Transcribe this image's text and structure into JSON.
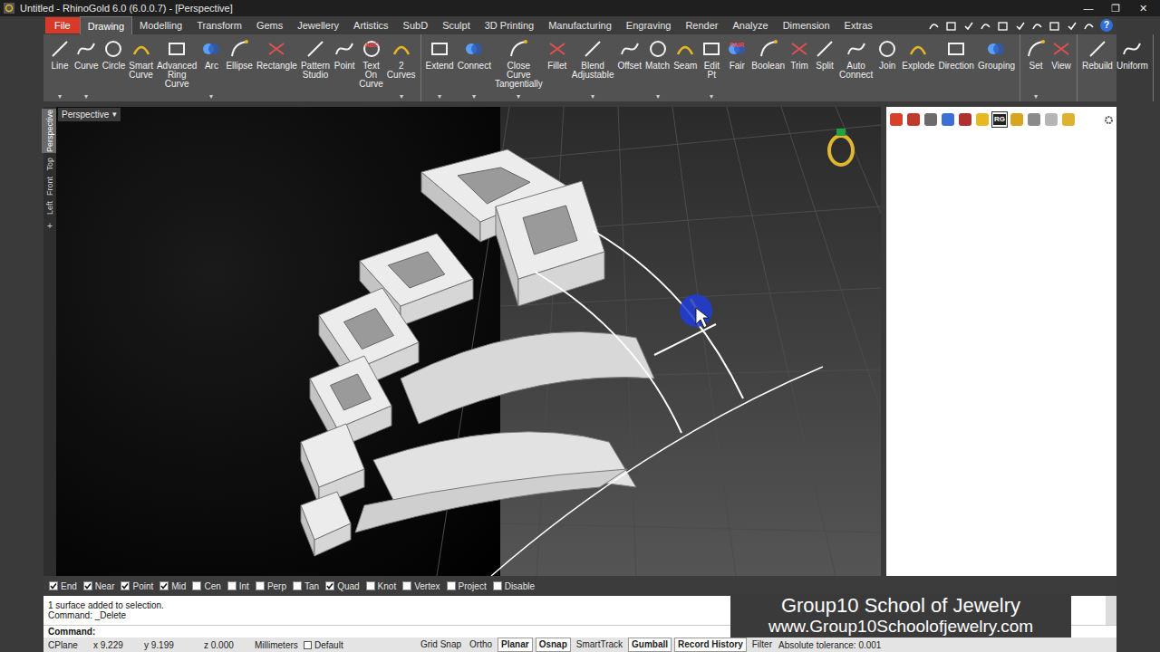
{
  "window": {
    "title": "Untitled - RhinoGold 6.0 (6.0.0.7) - [Perspective]",
    "controls": [
      "—",
      "❐",
      "✕"
    ]
  },
  "menu": {
    "file": "File",
    "help": "?",
    "tabs": [
      {
        "label": "Drawing",
        "selected": true
      },
      {
        "label": "Modelling",
        "selected": false
      },
      {
        "label": "Transform",
        "selected": false
      },
      {
        "label": "Gems",
        "selected": false
      },
      {
        "label": "Jewellery",
        "selected": false
      },
      {
        "label": "Artistics",
        "selected": false
      },
      {
        "label": "SubD",
        "selected": false
      },
      {
        "label": "Sculpt",
        "selected": false
      },
      {
        "label": "3D Printing",
        "selected": false
      },
      {
        "label": "Manufacturing",
        "selected": false
      },
      {
        "label": "Engraving",
        "selected": false
      },
      {
        "label": "Render",
        "selected": false
      },
      {
        "label": "Analyze",
        "selected": false
      },
      {
        "label": "Dimension",
        "selected": false
      },
      {
        "label": "Extras",
        "selected": false
      }
    ]
  },
  "ribbon": {
    "dropdown": "▾",
    "groups": [
      {
        "tools": [
          {
            "label": "Line",
            "menu": true
          },
          {
            "label": "Curve",
            "menu": true
          },
          {
            "label": "Circle",
            "menu": false
          },
          {
            "label": "Smart\nCurve",
            "menu": false
          },
          {
            "label": "Advanced\nRing Curve",
            "menu": false
          },
          {
            "label": "Arc",
            "menu": true
          },
          {
            "label": "Ellipse",
            "menu": false
          },
          {
            "label": "Rectangle",
            "menu": false
          },
          {
            "label": "Pattern\nStudio",
            "menu": false
          },
          {
            "label": "Point",
            "menu": false
          },
          {
            "label": "Text On\nCurve",
            "icon_text": "ABC",
            "menu": false
          },
          {
            "label": "2\nCurves",
            "menu": true
          }
        ]
      },
      {
        "tools": [
          {
            "label": "Extend",
            "menu": true
          },
          {
            "label": "Connect",
            "menu": true
          },
          {
            "label": "Close Curve\nTangentially",
            "menu": true
          },
          {
            "label": "Fillet",
            "menu": false
          },
          {
            "label": "Blend\nAdjustable",
            "menu": true
          },
          {
            "label": "Offset",
            "menu": false
          },
          {
            "label": "Match",
            "menu": true
          },
          {
            "label": "Seam",
            "menu": false
          },
          {
            "label": "Edit Pt",
            "menu": true
          },
          {
            "label": "Fair",
            "icon_text": "FAIR",
            "menu": false
          },
          {
            "label": "Boolean",
            "menu": false
          },
          {
            "label": "Trim",
            "menu": false
          },
          {
            "label": "Split",
            "menu": false
          },
          {
            "label": "Auto\nConnect",
            "menu": false
          },
          {
            "label": "Join",
            "menu": false
          },
          {
            "label": "Explode",
            "menu": false
          },
          {
            "label": "Direction",
            "menu": false
          },
          {
            "label": "Grouping",
            "menu": false
          }
        ]
      },
      {
        "tools": [
          {
            "label": "Set",
            "menu": true
          },
          {
            "label": "View",
            "menu": false
          }
        ]
      },
      {
        "tools": [
          {
            "label": "Rebuild",
            "menu": false
          },
          {
            "label": "Uniform",
            "menu": false
          }
        ]
      }
    ]
  },
  "viewport": {
    "label": "Perspective",
    "dropdown": "▾",
    "add": "+",
    "tabs": [
      {
        "label": "Perspective",
        "selected": true
      },
      {
        "label": "Top",
        "selected": false
      },
      {
        "label": "Front",
        "selected": false
      },
      {
        "label": "Left",
        "selected": false
      }
    ]
  },
  "panel": {
    "tabs": [
      {
        "selected": false,
        "color": "#d9402b"
      },
      {
        "selected": false,
        "color": "#c0392b"
      },
      {
        "selected": false,
        "color": "#6b6b6b"
      },
      {
        "selected": false,
        "color": "#3a6fd8"
      },
      {
        "selected": false,
        "color": "#b03030"
      },
      {
        "selected": false,
        "color": "#e8b820"
      },
      {
        "selected": true,
        "color": "#222222",
        "icon_text": "RG"
      },
      {
        "selected": false,
        "color": "#d9a520"
      },
      {
        "selected": false,
        "color": "#8a8a8a"
      },
      {
        "selected": false,
        "color": "#b5b5b5"
      },
      {
        "selected": false,
        "color": "#e0b030"
      }
    ]
  },
  "osnap": [
    {
      "label": "End",
      "checked": true
    },
    {
      "label": "Near",
      "checked": true
    },
    {
      "label": "Point",
      "checked": true
    },
    {
      "label": "Mid",
      "checked": true
    },
    {
      "label": "Cen",
      "checked": false
    },
    {
      "label": "Int",
      "checked": false
    },
    {
      "label": "Perp",
      "checked": false
    },
    {
      "label": "Tan",
      "checked": false
    },
    {
      "label": "Quad",
      "checked": true
    },
    {
      "label": "Knot",
      "checked": false
    },
    {
      "label": "Vertex",
      "checked": false
    },
    {
      "label": "Project",
      "checked": false
    },
    {
      "label": "Disable",
      "checked": false
    }
  ],
  "command": {
    "history": [
      "1 surface added to selection.",
      "Command: _Delete"
    ],
    "prompt": "Command:"
  },
  "watermark": {
    "title": "Group10 School of Jewelry",
    "url": "www.Group10Schoolofjewelry.com"
  },
  "status_bar": {
    "cplane": "CPlane",
    "x": "x 9.229",
    "y": "y 9.199",
    "z": "z 0.000",
    "units": "Millimeters",
    "layer": "Default",
    "toggles": [
      {
        "label": "Grid Snap",
        "active": false
      },
      {
        "label": "Ortho",
        "active": false
      },
      {
        "label": "Planar",
        "active": true
      },
      {
        "label": "Osnap",
        "active": true
      },
      {
        "label": "SmartTrack",
        "active": false
      },
      {
        "label": "Gumball",
        "active": true
      },
      {
        "label": "Record History",
        "active": true
      },
      {
        "label": "Filter",
        "active": false
      }
    ],
    "tolerance": "Absolute tolerance: 0.001"
  }
}
